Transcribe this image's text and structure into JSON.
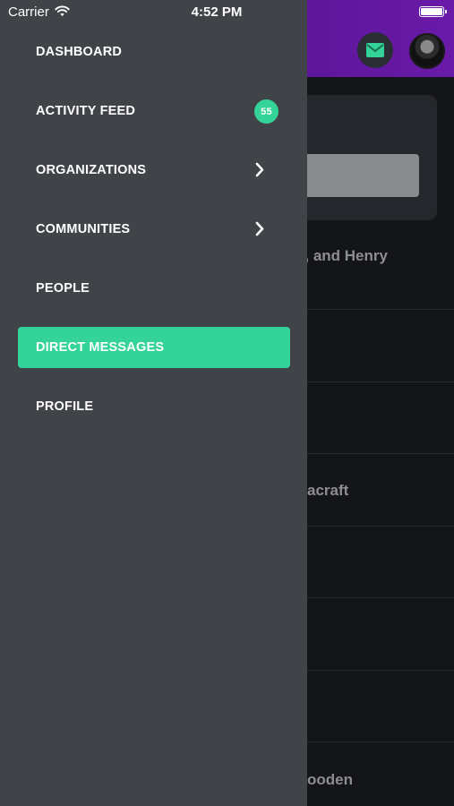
{
  "status_bar": {
    "carrier": "Carrier",
    "time": "4:52 PM"
  },
  "background": {
    "text_1": "n, and Henry",
    "text_2": "acraft",
    "text_3": "ooden"
  },
  "drawer": {
    "items": [
      {
        "label": "DASHBOARD"
      },
      {
        "label": "ACTIVITY FEED",
        "badge": "55"
      },
      {
        "label": "ORGANIZATIONS",
        "icon": "chevron-right-icon"
      },
      {
        "label": "COMMUNITIES",
        "icon": "chevron-right-icon"
      },
      {
        "label": "PEOPLE"
      },
      {
        "label": "DIRECT MESSAGES",
        "active": true
      },
      {
        "label": "PROFILE"
      }
    ]
  },
  "colors": {
    "accent": "#34d399",
    "drawer_bg": "#404348",
    "header_gradient_start": "#3a0f6b",
    "header_gradient_end": "#6a1aa8"
  }
}
